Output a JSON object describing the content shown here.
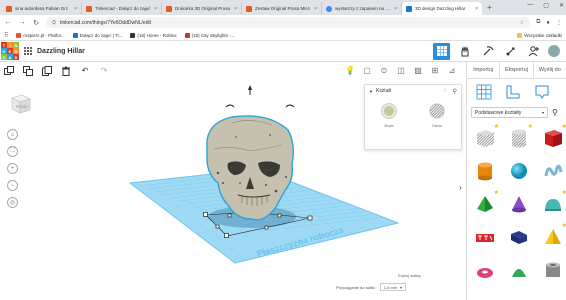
{
  "browser": {
    "tabs": [
      {
        "title": "sina autordesa Fabian Grz",
        "color": "#e05a2b"
      },
      {
        "title": "Tinkercad - Dołącz do zajęć",
        "color": "#e05a2b"
      },
      {
        "title": "Drukarka 3D Original Prusa",
        "color": "#e05a2b"
      },
      {
        "title": "Zestaw Original Prusa MK4",
        "color": "#e05a2b"
      },
      {
        "title": "wystarczy z zapasem na p...",
        "color": "#4285f4"
      },
      {
        "title": "3D design Dazzling Hillar",
        "color": "#1477d4",
        "active": true
      }
    ],
    "url": "tinkercad.com/things/7Ye6OddDwNL/edit",
    "bookmarks": [
      "m3pierz.pl - Platfor...",
      "Dołącz do zajęć | Ti...",
      "(18) Home - Roblox",
      "(18) City Skylights -..."
    ],
    "bookmarks_right": "Wszystkie zakładki"
  },
  "header": {
    "logo_letters": [
      "T",
      "I",
      "N",
      "K",
      "E",
      "R",
      "C",
      "A",
      "D"
    ],
    "logo_colors": [
      "#e03a2b",
      "#f7941d",
      "#8dc63f",
      "#27aae1",
      "#e03a2b",
      "#f7941d",
      "#8dc63f",
      "#27aae1",
      "#e03a2b"
    ],
    "design_title": "Dazzling Hillar",
    "accent": "#2a8ee0"
  },
  "right_panel": {
    "tabs": [
      "Importuj",
      "Eksportuj",
      "Wyślij do"
    ],
    "library": "Podstawowe kształty"
  },
  "shape_panel": {
    "title": "Kształt",
    "solid_label": "Bryła",
    "hole_label": "Otwór"
  },
  "workspace": {
    "edit_grid": "Edytuj siatkę",
    "snap_label": "Przyciąganie do siatki",
    "snap_value": "1,0 mm",
    "plane_text": "Płaszczyzna robocza",
    "cube_label": "PRZÓD",
    "grid_color": "#6ec3ec"
  }
}
